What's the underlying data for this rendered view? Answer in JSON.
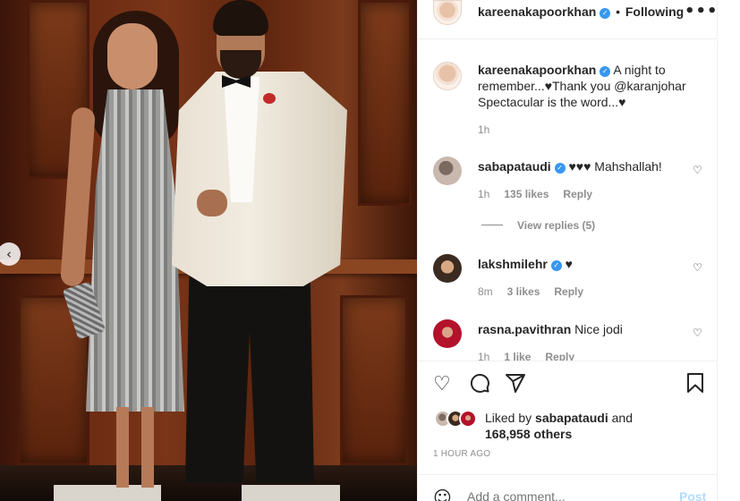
{
  "post": {
    "username": "kareenakapoorkhan",
    "follow_status": "Following",
    "caption_user": "kareenakapoorkhan",
    "caption": "A night to remember...♥Thank you @karanjohar Spectacular is the word...♥",
    "caption_time": "1h"
  },
  "comments": [
    {
      "user": "sabapataudi",
      "verified": true,
      "text": "♥♥♥ Mahshallah!",
      "time": "1h",
      "likes": "135 likes",
      "reply": "Reply",
      "view_replies": "View replies (5)"
    },
    {
      "user": "lakshmilehr",
      "verified": true,
      "text": "♥",
      "time": "8m",
      "likes": "3 likes",
      "reply": "Reply"
    },
    {
      "user": "rasna.pavithran",
      "verified": false,
      "text": "Nice jodi",
      "time": "1h",
      "likes": "1 like",
      "reply": "Reply"
    }
  ],
  "likes": {
    "prefix": "Liked by",
    "user": "sabapataudi",
    "and": "and",
    "others": "168,958 others"
  },
  "time_ago": "1 HOUR AGO",
  "add_comment": {
    "placeholder": "Add a comment...",
    "post_label": "Post"
  },
  "icons": [
    "heart-icon",
    "comment-icon",
    "share-icon",
    "bookmark-icon",
    "emoji-icon",
    "more-options-icon",
    "verified-badge-icon",
    "carousel-prev-icon"
  ],
  "colors": {
    "verified": "#3897f0",
    "muted": "#8e8e8e",
    "post_disabled": "#b3dbff"
  }
}
